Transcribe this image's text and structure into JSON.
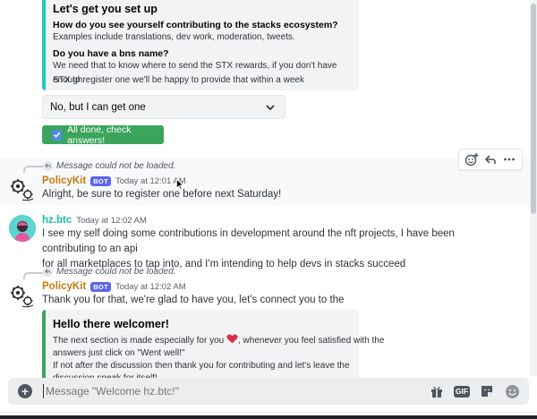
{
  "embed_top": {
    "title": "Let's get you set up",
    "fields": [
      {
        "name": "How do you see yourself contributing to the stacks ecosystem?",
        "value": "Examples include translations, dev work, moderation, tweets."
      },
      {
        "name": "Do you have a bns name?",
        "value_line1": "We need that to know where to send the STX rewards, if you don't have enough",
        "value_line2": "STX to register one we'll be happy to provide that within a week"
      }
    ],
    "accent_color": "#1fc7c2"
  },
  "select": {
    "value": "No, but I can get one"
  },
  "done_button": {
    "label": "All done, check answers!"
  },
  "messages": [
    {
      "reply_text": "Message could not be loaded.",
      "author": "PolicyKit",
      "badge": "BOT",
      "time": "Today at 12:01 AM",
      "text": "Alright, be sure to register one before next Saturday!",
      "author_color": "#c27c0e"
    },
    {
      "author": "hz.btc",
      "time": "Today at 12:02 AM",
      "text_line1": "I see my self doing some contributions in development around the nft projects, I have been contributing to an api",
      "text_line2": "for all marketplaces to tap into, and I'm intending to help devs  in stacks succeed",
      "author_color": "#1abc9c"
    },
    {
      "reply_text": "Message could not be loaded.",
      "author": "PolicyKit",
      "badge": "BOT",
      "time": "Today at 12:02 AM",
      "text": "Thank you for that, we're glad to have you, let's connect you to the <@&ADVOCATE_WELCOME_ROLE> team",
      "author_color": "#c27c0e"
    }
  ],
  "embed_bottom": {
    "title": "Hello there welcomer!",
    "line1_before": "The next section is made especially for you",
    "line1_after": ", whenever you feel satisfied with the",
    "line2": "answers just click on \"Went well!\"",
    "line3": "If not after the discussion then thank you for contributing and let's leave the",
    "line4": "discussion speak for itself!",
    "accent_color": "#3ba55c"
  },
  "hover_actions": [
    "add-reaction-icon",
    "reply-icon",
    "more-icon"
  ],
  "composer": {
    "placeholder": "Message \"Welcome hz.btc!\""
  },
  "composer_icons": [
    "gift-icon",
    "gif-icon",
    "sticker-icon",
    "emoji-icon"
  ],
  "gif_label": "GIF"
}
